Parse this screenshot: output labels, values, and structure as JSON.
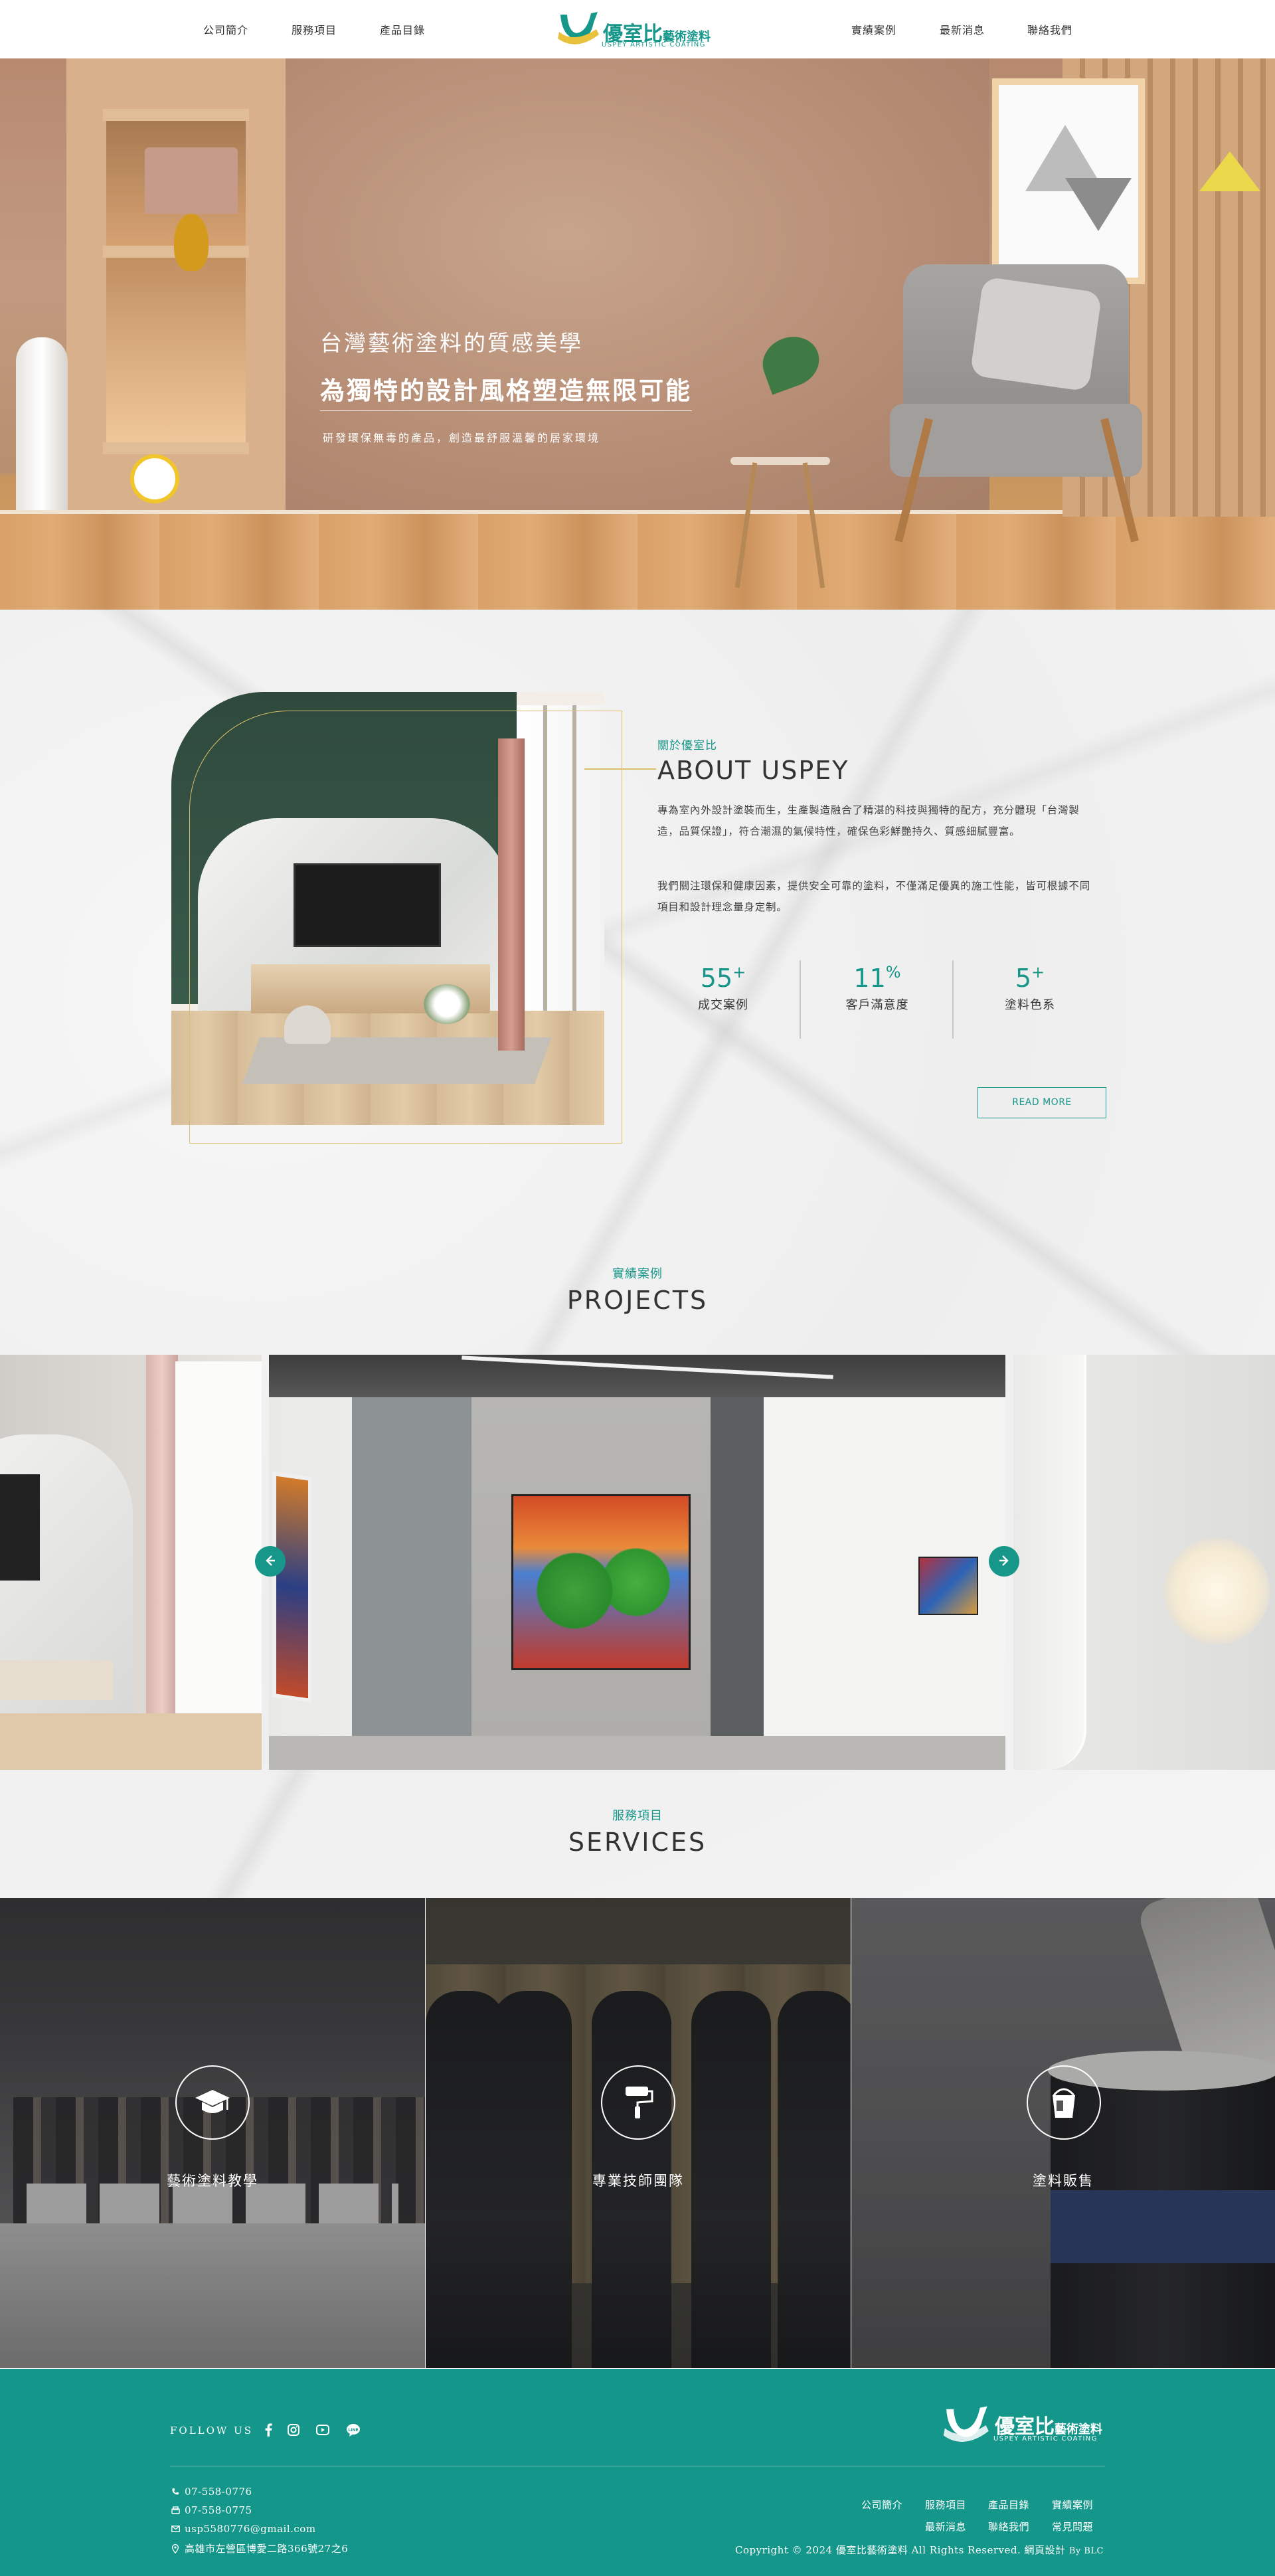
{
  "header": {
    "nav_left": [
      "公司簡介",
      "服務項目",
      "產品目錄"
    ],
    "nav_right": [
      "實績案例",
      "最新消息",
      "聯絡我們"
    ],
    "logo": {
      "cn_main": "優室比",
      "cn_sub": "藝術塗料",
      "en": "USPEY ARTISTIC COATING"
    }
  },
  "hero": {
    "line1": "台灣藝術塗料的質感美學",
    "line2": "為獨特的設計風格塑造無限可能",
    "line3": "研發環保無毒的產品，創造最舒服溫馨的居家環境"
  },
  "about": {
    "subtitle": "關於優室比",
    "title": "ABOUT USPEY",
    "paragraph1": "專為室內外設計塗裝而生，生產製造融合了精湛的科技與獨特的配方，充分體現「台灣製造，品質保證」，符合潮濕的氣候特性，確保色彩鮮艷持久、質感細膩豐富。",
    "paragraph2": "我們關注環保和健康因素，提供安全可靠的塗料，不僅滿足優異的施工性能，皆可根據不同項目和設計理念量身定制。",
    "stats": [
      {
        "value": "55",
        "suffix": "+",
        "label": "成交案例"
      },
      {
        "value": "11",
        "suffix": "%",
        "label": "客戶滿意度"
      },
      {
        "value": "5",
        "suffix": "+",
        "label": "塗料色系"
      }
    ],
    "read_more": "READ MORE"
  },
  "projects": {
    "subtitle": "實績案例",
    "title": "PROJECTS",
    "prev_icon": "arrow-left-icon",
    "next_icon": "arrow-right-icon"
  },
  "services": {
    "subtitle": "服務項目",
    "title": "SERVICES",
    "items": [
      {
        "label": "藝術塗料教學",
        "icon": "graduation-cap-icon"
      },
      {
        "label": "專業技師團隊",
        "icon": "paint-roller-icon"
      },
      {
        "label": "塗料販售",
        "icon": "paint-bucket-icon"
      }
    ]
  },
  "footer": {
    "follow": "FOLLOW US",
    "social_icons": [
      "facebook-icon",
      "instagram-icon",
      "youtube-icon",
      "line-icon"
    ],
    "contact": {
      "phone": "07-558-0776",
      "fax": "07-558-0775",
      "email": "usp5580776@gmail.com",
      "address": "高雄市左營區博愛二路366號27之6"
    },
    "links_row1": [
      "公司簡介",
      "服務項目",
      "產品目錄",
      "實績案例"
    ],
    "links_row2": [
      "最新消息",
      "聯絡我們",
      "常見問題"
    ],
    "copyright": "Copyright © 2024 優室比藝術塗料 All Rights Reserved. 網頁設計",
    "by": "By BLC"
  },
  "colors": {
    "accent": "#17978a",
    "gold": "#d9bf6a",
    "footer_bg": "#14968a"
  }
}
